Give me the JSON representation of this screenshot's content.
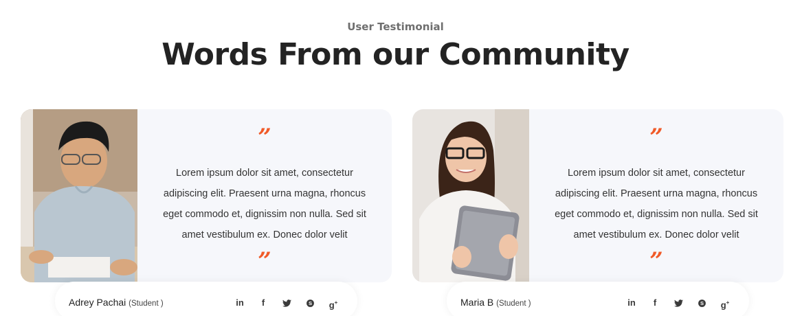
{
  "section": {
    "eyebrow": "User Testimonial",
    "heading": "Words From our Community"
  },
  "colors": {
    "accent": "#f05a28",
    "card_bg": "#f6f7fb",
    "heading": "#232323"
  },
  "testimonials": [
    {
      "quote_open": "”",
      "quote_close": "”",
      "text": "Lorem ipsum dolor sit amet, consectetur adipiscing elit. Praesent urna magna, rhoncus eget commodo et, dignissim non nulla. Sed sit amet vestibulum ex. Donec dolor velit",
      "name": "Adrey Pachai",
      "role": "(Student )",
      "photo": "student-male-photo",
      "socials": [
        "linkedin-icon",
        "facebook-icon",
        "twitter-icon",
        "skype-icon",
        "google-plus-icon"
      ]
    },
    {
      "quote_open": "”",
      "quote_close": "”",
      "text": "Lorem ipsum dolor sit amet, consectetur adipiscing elit. Praesent urna magna, rhoncus eget commodo et, dignissim non nulla. Sed sit amet vestibulum ex. Donec dolor velit",
      "name": "Maria B",
      "role": "(Student )",
      "photo": "student-female-tablet-photo",
      "socials": [
        "linkedin-icon",
        "facebook-icon",
        "twitter-icon",
        "skype-icon",
        "google-plus-icon"
      ]
    }
  ]
}
